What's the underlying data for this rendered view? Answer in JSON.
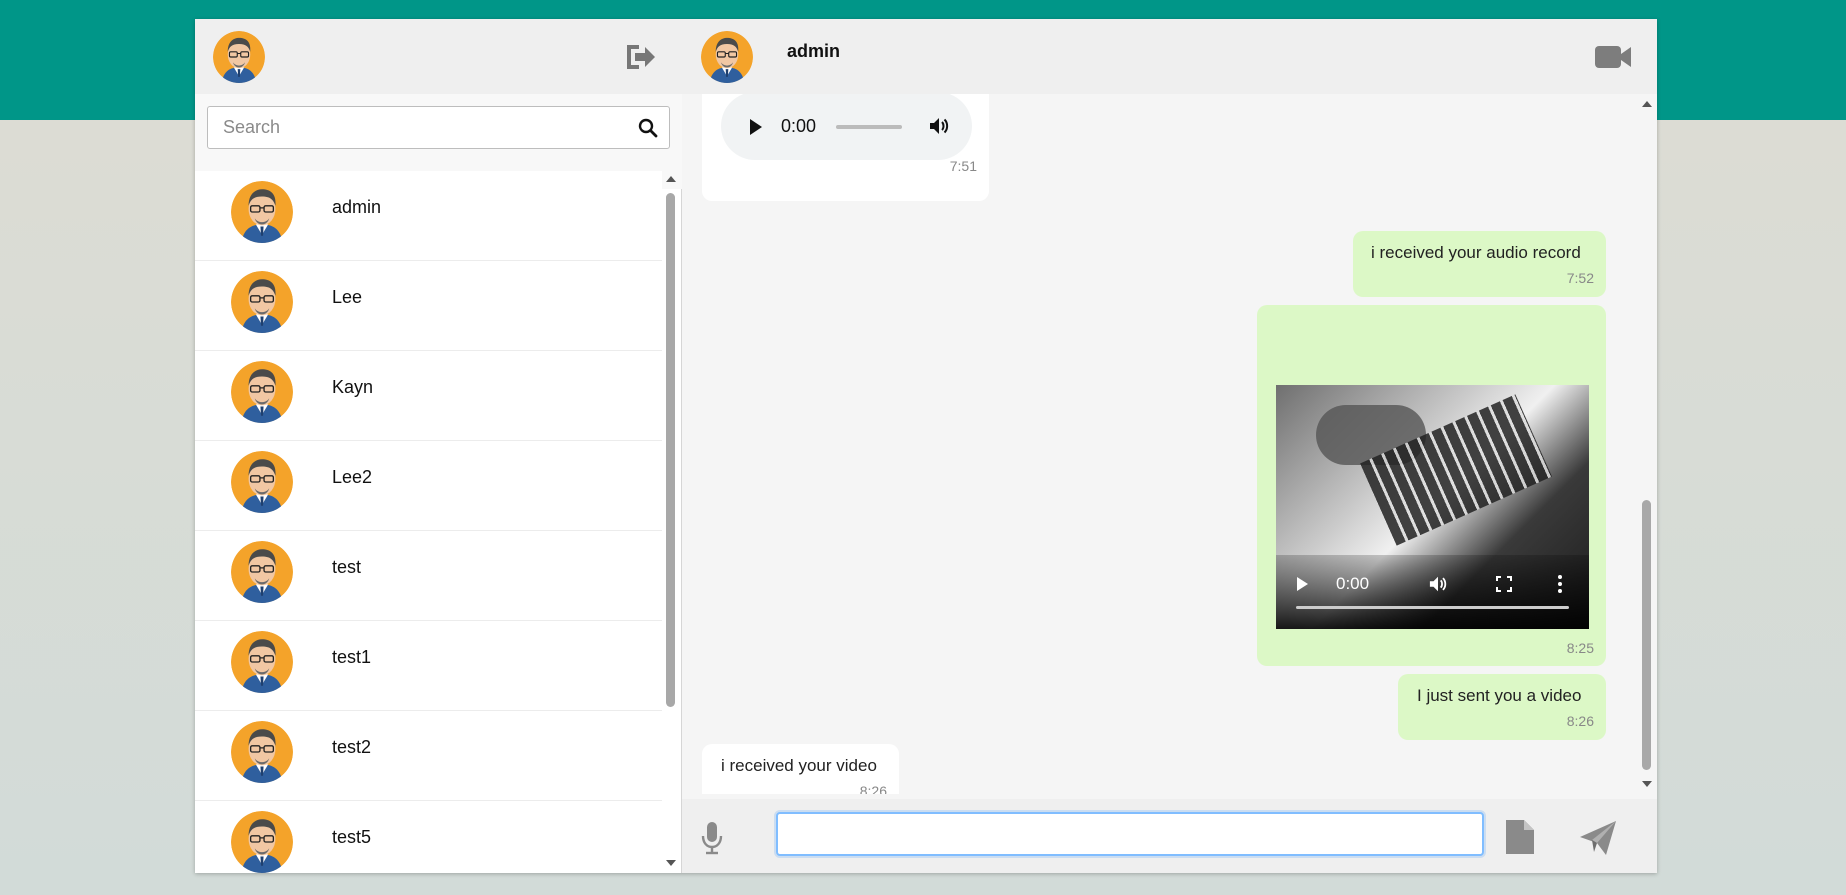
{
  "sidebar": {
    "search": {
      "placeholder": "Search",
      "value": ""
    },
    "contacts": [
      {
        "name": "admin"
      },
      {
        "name": "Lee"
      },
      {
        "name": "Kayn"
      },
      {
        "name": "Lee2"
      },
      {
        "name": "test"
      },
      {
        "name": "test1"
      },
      {
        "name": "test2"
      },
      {
        "name": "test5"
      }
    ]
  },
  "chat": {
    "title": "admin",
    "messages": [
      {
        "type": "audio",
        "direction": "incoming",
        "duration": "0:00",
        "time": "7:51"
      },
      {
        "type": "text",
        "direction": "outgoing",
        "text": "i received your audio record",
        "time": "7:52"
      },
      {
        "type": "video",
        "direction": "outgoing",
        "duration": "0:00",
        "time": "8:25"
      },
      {
        "type": "text",
        "direction": "outgoing",
        "text": "I just sent you a video",
        "time": "8:26"
      },
      {
        "type": "text",
        "direction": "incoming",
        "text": "i received your video",
        "time": "8:26"
      }
    ],
    "composer": {
      "value": "",
      "placeholder": ""
    }
  },
  "icons": {
    "logout": "sign-out-icon",
    "search": "search-icon",
    "video_call": "video-camera-icon",
    "mic": "microphone-icon",
    "file": "file-icon",
    "send": "paper-plane-icon"
  },
  "colors": {
    "header_band": "#009688",
    "outgoing_bubble": "#dcf8c6",
    "incoming_bubble": "#ffffff",
    "panel_header": "#efefef",
    "avatar_bg": "#f4a32a"
  }
}
